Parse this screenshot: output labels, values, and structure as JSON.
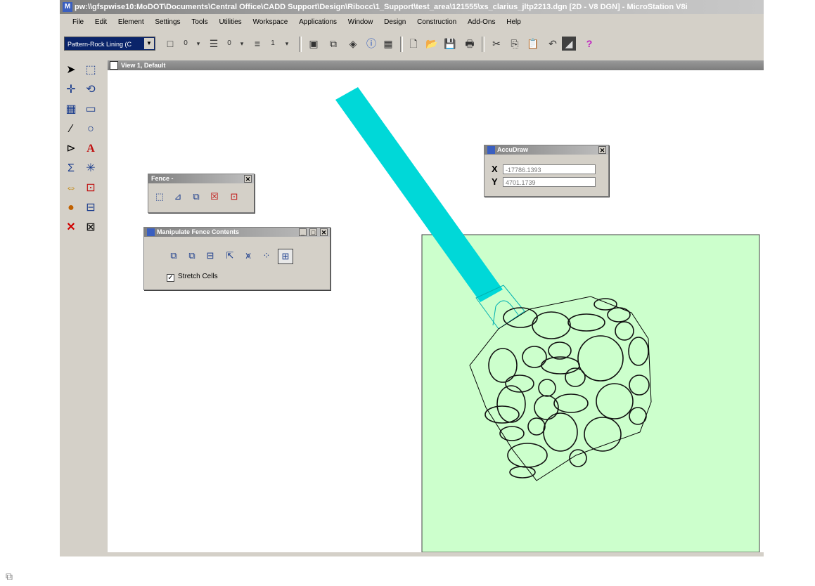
{
  "window": {
    "title": "pw:\\\\gfspwise10:MoDOT\\Documents\\Central Office\\CADD Support\\Design\\Ribocc\\1_Support\\test_area\\121555\\xs_clarius_jltp2213.dgn [2D - V8 DGN] - MicroStation V8i"
  },
  "menu": {
    "items": [
      "File",
      "Edit",
      "Element",
      "Settings",
      "Tools",
      "Utilities",
      "Workspace",
      "Applications",
      "Window",
      "Design",
      "Construction",
      "Add-Ons",
      "Help"
    ]
  },
  "toolbar": {
    "level": "Pattern-Rock Lining (C",
    "color_value": "0",
    "style_value": "0",
    "weight_value": "1",
    "help_glyph": "?"
  },
  "view": {
    "title": "View 1, Default"
  },
  "accudraw": {
    "title": "AccuDraw",
    "x_label": "X",
    "x_value": "-17786.1393",
    "y_label": "Y",
    "y_value": "4701.1739"
  },
  "fence": {
    "title": "Fence -"
  },
  "manipulate": {
    "title": "Manipulate Fence Contents",
    "stretch_label": "Stretch Cells",
    "stretch_checked": true
  },
  "colors": {
    "cyan_shape": "#00d8d8",
    "fence_fill": "#ccffcc",
    "titlebar": "#808080"
  },
  "icons": {
    "status_icon": "window-restore-icon"
  }
}
